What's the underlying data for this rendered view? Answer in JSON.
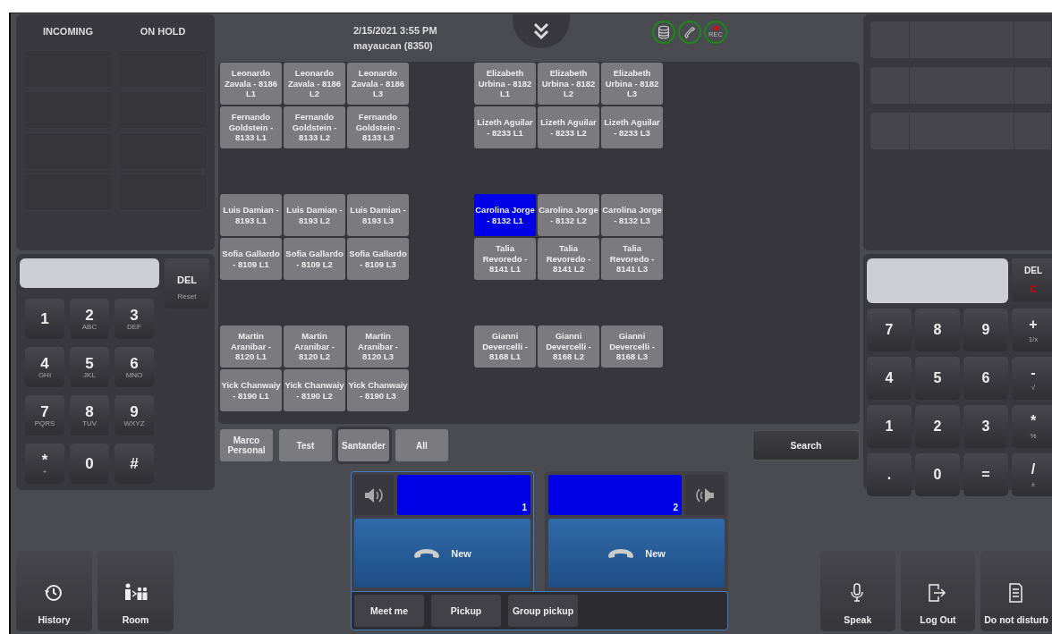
{
  "header": {
    "datetime": "2/15/2021 3:55 PM",
    "user": "mayaucan (8350)",
    "status_icons": [
      {
        "kind": "database"
      },
      {
        "kind": "phone"
      },
      {
        "kind": "rec",
        "label": "REC"
      }
    ]
  },
  "queues": [
    {
      "title": "INCOMING"
    },
    {
      "title": "ON HOLD"
    }
  ],
  "dialpad": {
    "del": "DEL",
    "reset": "Reset",
    "keys": [
      {
        "digit": "1"
      },
      {
        "digit": "2",
        "letters": "ABC"
      },
      {
        "digit": "3",
        "letters": "DEF"
      },
      {
        "digit": "4",
        "letters": "GHI"
      },
      {
        "digit": "5",
        "letters": "JKL"
      },
      {
        "digit": "6",
        "letters": "MNO"
      },
      {
        "digit": "7",
        "letters": "PQRS"
      },
      {
        "digit": "8",
        "letters": "TUV"
      },
      {
        "digit": "9",
        "letters": "WXYZ"
      },
      {
        "digit": "*",
        "letters": "+"
      },
      {
        "digit": "0"
      },
      {
        "digit": "#"
      }
    ]
  },
  "speed_dial": {
    "rows": [
      [
        {
          "label": "Leonardo Zavala - 8186 L1",
          "selected": false
        },
        {
          "label": "Leonardo Zavala - 8186 L2",
          "selected": false
        },
        {
          "label": "Leonardo Zavala - 8186 L3",
          "selected": false
        },
        null,
        {
          "label": "Elizabeth Urbina - 8182 L1",
          "selected": false
        },
        {
          "label": "Elizabeth Urbina - 8182 L2",
          "selected": false
        },
        {
          "label": "Elizabeth Urbina - 8182 L3",
          "selected": false
        }
      ],
      [
        {
          "label": "Fernando Goldstein - 8133 L1",
          "selected": false
        },
        {
          "label": "Fernando Goldstein - 8133 L2",
          "selected": false
        },
        {
          "label": "Fernando Goldstein - 8133 L3",
          "selected": false
        },
        null,
        {
          "label": "Lizeth Aguilar - 8233 L1",
          "selected": false
        },
        {
          "label": "Lizeth Aguilar - 8233 L2",
          "selected": false
        },
        {
          "label": "Lizeth Aguilar - 8233 L3",
          "selected": false
        }
      ],
      [
        null,
        null,
        null,
        null,
        null,
        null,
        null
      ],
      [
        {
          "label": "Luis Damian - 8193 L1",
          "selected": false
        },
        {
          "label": "Luis Damian - 8193 L2",
          "selected": false
        },
        {
          "label": "Luis Damian - 8193 L3",
          "selected": false
        },
        null,
        {
          "label": "Carolina Jorge - 8132 L1",
          "selected": true
        },
        {
          "label": "Carolina Jorge - 8132 L2",
          "selected": false
        },
        {
          "label": "Carolina Jorge - 8132 L3",
          "selected": false
        }
      ],
      [
        {
          "label": "Sofia Gallardo - 8109 L1",
          "selected": false
        },
        {
          "label": "Sofia Gallardo - 8109 L2",
          "selected": false
        },
        {
          "label": "Sofia Gallardo - 8109 L3",
          "selected": false
        },
        null,
        {
          "label": "Talia Revoredo - 8141 L1",
          "selected": false
        },
        {
          "label": "Talia Revoredo - 8141 L2",
          "selected": false
        },
        {
          "label": "Talia Revoredo - 8141 L3",
          "selected": false
        }
      ],
      [
        null,
        null,
        null,
        null,
        null,
        null,
        null
      ],
      [
        {
          "label": "Martin Aranibar - 8120 L1",
          "selected": false
        },
        {
          "label": "Martin Aranibar - 8120 L2",
          "selected": false
        },
        {
          "label": "Martin Aranibar - 8120 L3",
          "selected": false
        },
        null,
        {
          "label": "Gianni Devercelli - 8168 L1",
          "selected": false
        },
        {
          "label": "Gianni Devercelli - 8168 L2",
          "selected": false
        },
        {
          "label": "Gianni Devercelli - 8168 L3",
          "selected": false
        }
      ],
      [
        {
          "label": "Yick Chanwaiy - 8190 L1",
          "selected": false
        },
        {
          "label": "Yick Chanwaiy - 8190 L2",
          "selected": false
        },
        {
          "label": "Yick Chanwaiy - 8190 L3",
          "selected": false
        },
        null,
        null,
        null,
        null
      ]
    ]
  },
  "groups": [
    {
      "label": "Marco Personal",
      "selected": false
    },
    {
      "label": "Test",
      "selected": false
    },
    {
      "label": "Santander",
      "selected": true
    },
    {
      "label": "All",
      "selected": false
    }
  ],
  "search_button": "Search",
  "lines": [
    {
      "number": "1",
      "selected": true,
      "new_label": "New"
    },
    {
      "number": "2",
      "selected": false,
      "new_label": "New"
    }
  ],
  "line_actions": [
    "Meet me",
    "Pickup",
    "Group pickup"
  ],
  "calculator": {
    "del": "DEL",
    "clear": "C",
    "keys": [
      {
        "main": "7"
      },
      {
        "main": "8"
      },
      {
        "main": "9"
      },
      {
        "main": "+",
        "sub": "1/x"
      },
      {
        "main": "4"
      },
      {
        "main": "5"
      },
      {
        "main": "6"
      },
      {
        "main": "-",
        "sub": "√"
      },
      {
        "main": "1"
      },
      {
        "main": "2"
      },
      {
        "main": "3"
      },
      {
        "main": "*",
        "sub": "%"
      },
      {
        "main": "."
      },
      {
        "main": "0"
      },
      {
        "main": "="
      },
      {
        "main": "/",
        "sub": "±"
      }
    ]
  },
  "left_actions": [
    {
      "kind": "history",
      "label": "History"
    },
    {
      "kind": "room",
      "label": "Room"
    }
  ],
  "right_actions": [
    {
      "kind": "speak",
      "label": "Speak"
    },
    {
      "kind": "logout",
      "label": "Log Out"
    },
    {
      "kind": "dnd",
      "label": "Do not disturb"
    }
  ]
}
